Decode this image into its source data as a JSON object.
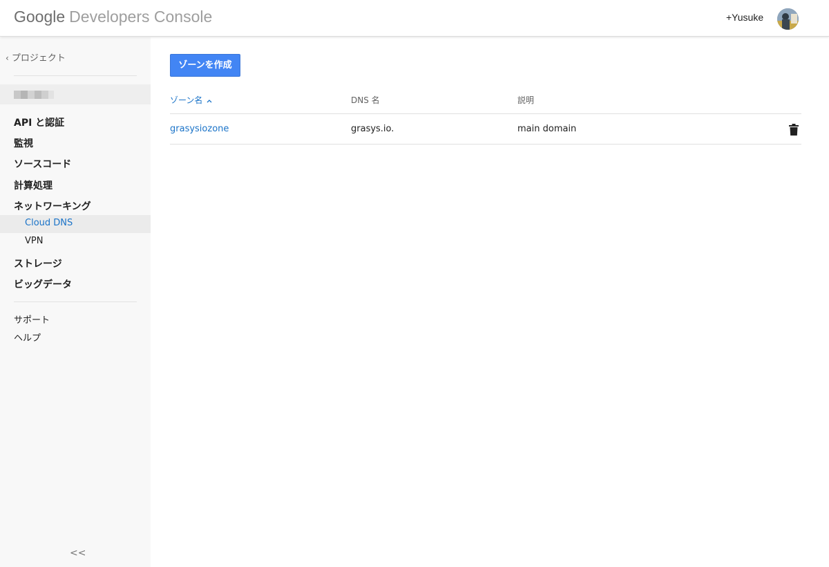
{
  "header": {
    "logo_google": "Google",
    "logo_rest": "Developers Console",
    "user_name": "+Yusuke"
  },
  "sidebar": {
    "back_label": "プロジェクト",
    "nav": [
      {
        "label": "API と認証"
      },
      {
        "label": "監視"
      },
      {
        "label": "ソースコード"
      },
      {
        "label": "計算処理"
      },
      {
        "label": "ネットワーキング"
      }
    ],
    "sub": [
      {
        "label": "Cloud DNS",
        "active": true
      },
      {
        "label": "VPN"
      }
    ],
    "nav2": [
      {
        "label": "ストレージ"
      },
      {
        "label": "ビッグデータ"
      }
    ],
    "footer": [
      {
        "label": "サポート"
      },
      {
        "label": "ヘルプ"
      }
    ],
    "collapse_label": "<<"
  },
  "main": {
    "create_button": "ゾーンを作成",
    "columns": [
      "ゾーン名",
      "DNS 名",
      "説明"
    ],
    "rows": [
      {
        "zone": "grasysiozone",
        "dns": "grasys.io.",
        "description": "main domain"
      }
    ]
  },
  "colors": {
    "accent_blue": "#4285f4",
    "link_blue": "#1a73c8",
    "sidebar_bg": "#f8f8f8"
  }
}
